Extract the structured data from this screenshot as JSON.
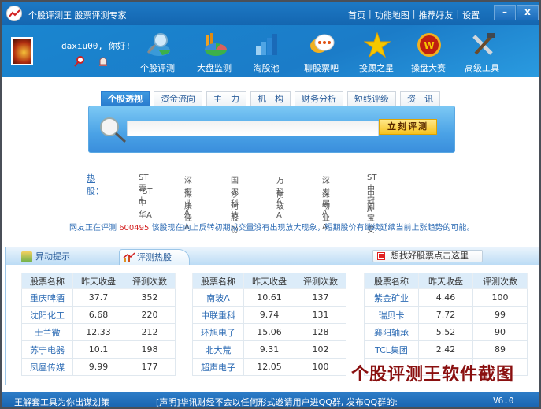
{
  "window": {
    "title": "个股评测王  股票评测专家",
    "top_links": [
      "首页",
      "功能地图",
      "推荐好友",
      "设置"
    ],
    "minimize_label": "–",
    "close_label": "x"
  },
  "header": {
    "greeting": "daxiu00, 你好!",
    "nav": [
      {
        "label": "个股评测",
        "icon": "magnifier-chart-icon"
      },
      {
        "label": "大盘监测",
        "icon": "pie-chart-icon"
      },
      {
        "label": "淘股池",
        "icon": "bar-chart-icon"
      },
      {
        "label": "聊股票吧",
        "icon": "chat-bubble-icon"
      },
      {
        "label": "投顾之星",
        "icon": "star-icon"
      },
      {
        "label": "操盘大赛",
        "icon": "medal-icon"
      },
      {
        "label": "高级工具",
        "icon": "tools-icon"
      }
    ]
  },
  "search": {
    "tabs": [
      "个股透视",
      "资金流向",
      "主　力",
      "机　构",
      "财务分析",
      "短线评级",
      "资　讯"
    ],
    "active_tab": 0,
    "input_value": "",
    "button_label": "立刻评测"
  },
  "hot": {
    "label": "热股：",
    "row1": [
      "ST零七",
      "深振业A",
      "国农科技",
      "万 科A",
      "深发展A",
      "ST中冠A"
    ],
    "row2": [
      "*ST中华A",
      "深康佳A",
      "沙河股份",
      "南 玻A",
      "深物业A",
      "中国宝安"
    ]
  },
  "notice": {
    "prefix": "网友正在评测",
    "code": "600495",
    "text": "该股现在向上反转初期成交量没有出现放大现象，短期股价有继续延续当前上涨趋势的可能。"
  },
  "panel": {
    "tabs": [
      "异动提示",
      "评测热股"
    ],
    "active_tab": 1,
    "find_button": "想找好股票点击这里",
    "headers": [
      "股票名称",
      "昨天收盘",
      "评测次数"
    ],
    "tables": [
      [
        [
          "重庆啤酒",
          "37.7",
          "352"
        ],
        [
          "沈阳化工",
          "6.68",
          "220"
        ],
        [
          "士兰微",
          "12.33",
          "212"
        ],
        [
          "苏宁电器",
          "10.1",
          "198"
        ],
        [
          "凤凰传媒",
          "9.99",
          "177"
        ]
      ],
      [
        [
          "南玻A",
          "10.61",
          "137"
        ],
        [
          "中联重科",
          "9.74",
          "131"
        ],
        [
          "环旭电子",
          "15.06",
          "128"
        ],
        [
          "北大荒",
          "9.31",
          "102"
        ],
        [
          "超声电子",
          "12.05",
          "100"
        ]
      ],
      [
        [
          "紫金矿业",
          "4.46",
          "100"
        ],
        [
          "瑞贝卡",
          "7.72",
          "99"
        ],
        [
          "襄阳轴承",
          "5.52",
          "90"
        ],
        [
          "TCL集团",
          "2.42",
          "89"
        ],
        [
          "",
          "",
          ""
        ]
      ]
    ]
  },
  "watermark": "个股评测王软件截图",
  "status": {
    "left": "王解套工具为你出谋划策",
    "middle": "[声明]华讯财经不会以任何形式邀请用户进QQ群, 发布QQ群的:",
    "version": "V6.0"
  }
}
